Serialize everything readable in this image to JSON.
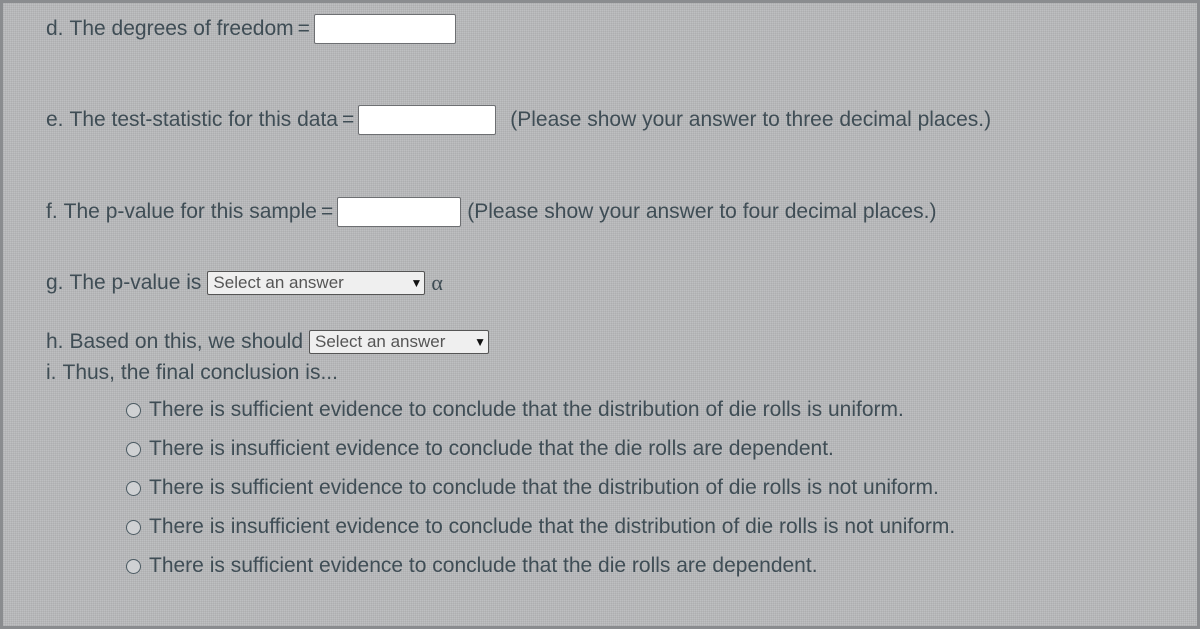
{
  "d": {
    "label": "d.",
    "text": "The degrees of freedom",
    "eq": "="
  },
  "e": {
    "label": "e.",
    "text": "The test-statistic for this data",
    "eq": "=",
    "hint": "(Please show your answer to three decimal places.)"
  },
  "f": {
    "label": "f.",
    "text": "The p-value for this sample",
    "eq": "=",
    "hint": "(Please show your answer to four decimal places.)"
  },
  "g": {
    "label": "g.",
    "text": "The p-value is",
    "select_placeholder": "Select an answer",
    "alpha": "α"
  },
  "h": {
    "label": "h.",
    "text": "Based on this, we should",
    "select_placeholder": "Select an answer"
  },
  "i": {
    "label": "i.",
    "text": "Thus, the final conclusion is..."
  },
  "options": [
    "There is sufficient evidence to conclude that the distribution of die rolls is uniform.",
    "There is insufficient evidence to conclude that the die rolls are dependent.",
    "There is sufficient evidence to conclude that the distribution of die rolls is not uniform.",
    "There is insufficient evidence to conclude that the distribution of die rolls is not uniform.",
    "There is sufficient evidence to conclude that the die rolls are dependent."
  ]
}
